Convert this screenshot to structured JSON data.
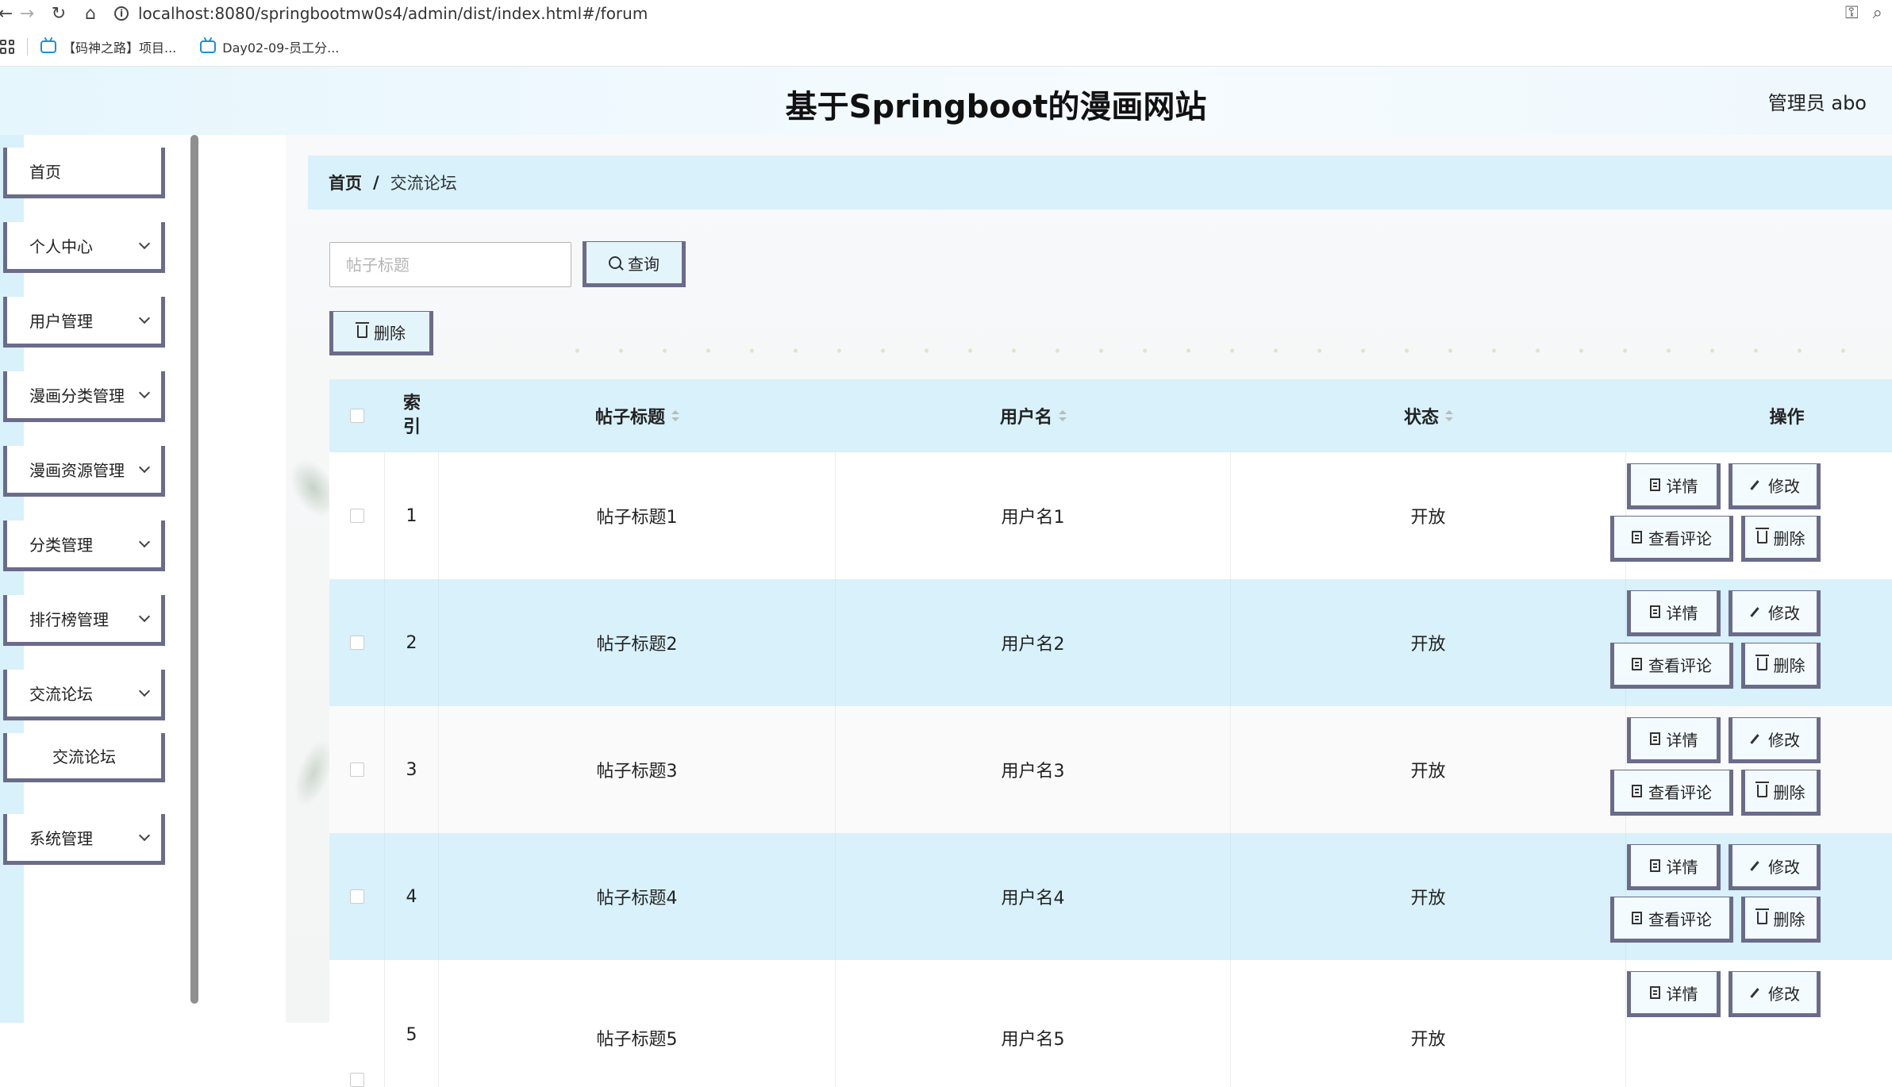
{
  "browser": {
    "url": "localhost:8080/springbootmw0s4/admin/dist/index.html#/forum",
    "bookmarks": [
      {
        "label": "【码神之路】项目..."
      },
      {
        "label": "Day02-09-员工分..."
      }
    ]
  },
  "header": {
    "title": "基于Springboot的漫画网站",
    "admin": "管理员 abo"
  },
  "sidebar": {
    "items": [
      {
        "label": "首页"
      },
      {
        "label": "个人中心"
      },
      {
        "label": "用户管理"
      },
      {
        "label": "漫画分类管理"
      },
      {
        "label": "漫画资源管理"
      },
      {
        "label": "分类管理"
      },
      {
        "label": "排行榜管理"
      },
      {
        "label": "交流论坛"
      },
      {
        "label": "交流论坛"
      },
      {
        "label": "系统管理"
      }
    ]
  },
  "breadcrumb": {
    "home": "首页",
    "separator": "/",
    "current": "交流论坛"
  },
  "toolbar": {
    "search_placeholder": "帖子标题",
    "search_label": "查询",
    "delete_label": "删除"
  },
  "table": {
    "columns": {
      "index": "索\n引",
      "title": "帖子标题",
      "username": "用户名",
      "status": "状态",
      "actions": "操作"
    },
    "actions": {
      "detail": "详情",
      "edit": "修改",
      "comments": "查看评论",
      "delete": "删除"
    },
    "rows": [
      {
        "index": "1",
        "title": "帖子标题1",
        "username": "用户名1",
        "status": "开放"
      },
      {
        "index": "2",
        "title": "帖子标题2",
        "username": "用户名2",
        "status": "开放"
      },
      {
        "index": "3",
        "title": "帖子标题3",
        "username": "用户名3",
        "status": "开放"
      },
      {
        "index": "4",
        "title": "帖子标题4",
        "username": "用户名4",
        "status": "开放"
      },
      {
        "index": "5",
        "title": "帖子标题5",
        "username": "用户名5",
        "status": "开放"
      }
    ]
  }
}
